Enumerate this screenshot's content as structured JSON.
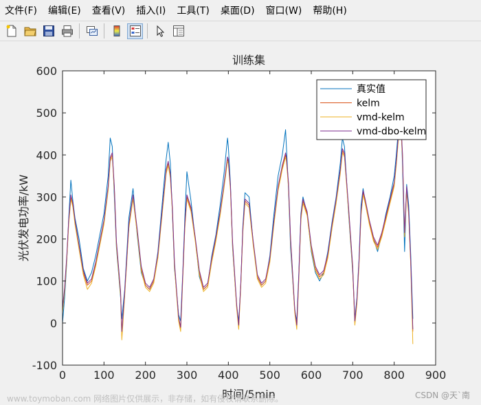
{
  "menubar": {
    "items": [
      "文件(F)",
      "编辑(E)",
      "查看(V)",
      "插入(I)",
      "工具(T)",
      "桌面(D)",
      "窗口(W)",
      "帮助(H)"
    ]
  },
  "toolbar": {
    "icons": [
      "new-figure-icon",
      "open-file-icon",
      "save-icon",
      "print-icon",
      "link-plot-icon",
      "insert-colorbar-icon",
      "insert-legend-icon",
      "pointer-icon",
      "property-inspector-icon"
    ]
  },
  "watermarks": {
    "left": "www.toymoban.com 网络图片仅供展示，非存储，如有侵权请联系删除。",
    "right": "CSDN @天`南"
  },
  "chart_data": {
    "type": "line",
    "title": "训练集",
    "xlabel": "时间/5min",
    "ylabel": "光伏发电功率/kW",
    "xlim": [
      0,
      900
    ],
    "ylim": [
      -100,
      600
    ],
    "xticks": [
      "0",
      "100",
      "200",
      "300",
      "400",
      "500",
      "600",
      "700",
      "800",
      "900"
    ],
    "yticks": [
      "-100",
      "0",
      "100",
      "200",
      "300",
      "400",
      "500",
      "600"
    ],
    "grid": false,
    "legend_position": "top-right",
    "colors": {
      "真实值": "#0072BD",
      "kelm": "#D95319",
      "vmd-kelm": "#EDB120",
      "vmd-dbo-kelm": "#7E2F8E"
    },
    "series": [
      {
        "name": "真实值",
        "x": [
          0,
          5,
          10,
          15,
          20,
          25,
          30,
          40,
          50,
          60,
          70,
          80,
          90,
          100,
          110,
          115,
          120,
          125,
          130,
          140,
          143,
          150,
          160,
          170,
          180,
          190,
          200,
          210,
          220,
          230,
          240,
          250,
          255,
          260,
          265,
          270,
          280,
          285,
          290,
          295,
          300,
          310,
          320,
          330,
          340,
          350,
          360,
          370,
          380,
          390,
          398,
          400,
          405,
          410,
          420,
          425,
          430,
          435,
          440,
          450,
          460,
          470,
          480,
          490,
          500,
          510,
          520,
          530,
          538,
          540,
          545,
          550,
          560,
          565,
          570,
          575,
          580,
          590,
          600,
          610,
          620,
          630,
          640,
          650,
          660,
          670,
          675,
          680,
          690,
          700,
          705,
          710,
          715,
          720,
          725,
          730,
          740,
          750,
          760,
          770,
          780,
          790,
          800,
          805,
          810,
          815,
          820,
          825,
          830,
          835,
          840,
          845
        ],
        "y": [
          0,
          60,
          140,
          250,
          340,
          290,
          250,
          200,
          130,
          100,
          120,
          160,
          210,
          260,
          350,
          440,
          420,
          300,
          180,
          60,
          10,
          80,
          250,
          320,
          210,
          120,
          90,
          80,
          100,
          170,
          280,
          390,
          430,
          380,
          260,
          130,
          20,
          5,
          120,
          250,
          360,
          290,
          200,
          110,
          80,
          90,
          160,
          210,
          280,
          360,
          440,
          420,
          330,
          180,
          40,
          5,
          90,
          230,
          310,
          300,
          190,
          110,
          90,
          100,
          160,
          260,
          350,
          400,
          460,
          420,
          320,
          180,
          30,
          5,
          120,
          260,
          300,
          260,
          170,
          120,
          100,
          120,
          170,
          240,
          300,
          380,
          440,
          420,
          260,
          120,
          10,
          60,
          150,
          280,
          320,
          290,
          240,
          200,
          170,
          210,
          260,
          300,
          350,
          400,
          460,
          520,
          380,
          170,
          330,
          280,
          160,
          10
        ]
      },
      {
        "name": "kelm",
        "x": [
          0,
          5,
          10,
          15,
          20,
          25,
          30,
          40,
          50,
          60,
          70,
          80,
          90,
          100,
          110,
          115,
          120,
          125,
          130,
          140,
          143,
          150,
          160,
          170,
          180,
          190,
          200,
          210,
          220,
          230,
          240,
          250,
          255,
          260,
          265,
          270,
          280,
          285,
          290,
          295,
          300,
          310,
          320,
          330,
          340,
          350,
          360,
          370,
          380,
          390,
          398,
          400,
          405,
          410,
          420,
          425,
          430,
          435,
          440,
          450,
          460,
          470,
          480,
          490,
          500,
          510,
          520,
          530,
          538,
          540,
          545,
          550,
          560,
          565,
          570,
          575,
          580,
          590,
          600,
          610,
          620,
          630,
          640,
          650,
          660,
          670,
          675,
          680,
          690,
          700,
          705,
          710,
          715,
          720,
          725,
          730,
          740,
          750,
          760,
          770,
          780,
          790,
          800,
          805,
          810,
          815,
          820,
          825,
          830,
          835,
          840,
          845
        ],
        "y": [
          30,
          80,
          150,
          240,
          300,
          280,
          240,
          180,
          120,
          90,
          100,
          140,
          190,
          240,
          320,
          390,
          400,
          320,
          190,
          70,
          -30,
          70,
          230,
          300,
          220,
          130,
          90,
          80,
          100,
          160,
          260,
          360,
          380,
          350,
          270,
          140,
          10,
          -15,
          110,
          230,
          300,
          270,
          200,
          120,
          80,
          90,
          150,
          200,
          260,
          330,
          390,
          385,
          320,
          190,
          40,
          -10,
          90,
          220,
          290,
          280,
          190,
          110,
          90,
          100,
          150,
          240,
          320,
          370,
          400,
          390,
          330,
          200,
          30,
          -10,
          110,
          250,
          290,
          260,
          180,
          130,
          110,
          120,
          160,
          230,
          290,
          360,
          410,
          400,
          270,
          130,
          0,
          50,
          140,
          260,
          310,
          290,
          240,
          200,
          180,
          210,
          250,
          290,
          330,
          380,
          440,
          490,
          400,
          210,
          320,
          260,
          140,
          -20
        ]
      },
      {
        "name": "vmd-kelm",
        "x": [
          0,
          5,
          10,
          15,
          20,
          25,
          30,
          40,
          50,
          60,
          70,
          80,
          90,
          100,
          110,
          115,
          120,
          125,
          130,
          140,
          143,
          150,
          160,
          170,
          180,
          190,
          200,
          210,
          220,
          230,
          240,
          250,
          255,
          260,
          265,
          270,
          280,
          285,
          290,
          295,
          300,
          310,
          320,
          330,
          340,
          350,
          360,
          370,
          380,
          390,
          398,
          400,
          405,
          410,
          420,
          425,
          430,
          435,
          440,
          450,
          460,
          470,
          480,
          490,
          500,
          510,
          520,
          530,
          538,
          540,
          545,
          550,
          560,
          565,
          570,
          575,
          580,
          590,
          600,
          610,
          620,
          630,
          640,
          650,
          660,
          670,
          675,
          680,
          690,
          700,
          705,
          710,
          715,
          720,
          725,
          730,
          740,
          750,
          760,
          770,
          780,
          790,
          800,
          805,
          810,
          815,
          820,
          825,
          830,
          835,
          840,
          845
        ],
        "y": [
          25,
          75,
          145,
          235,
          295,
          275,
          235,
          175,
          115,
          80,
          95,
          135,
          185,
          235,
          315,
          385,
          395,
          315,
          185,
          65,
          -40,
          65,
          225,
          295,
          215,
          125,
          85,
          75,
          95,
          155,
          255,
          355,
          375,
          345,
          265,
          135,
          5,
          -20,
          105,
          225,
          295,
          265,
          195,
          115,
          75,
          85,
          145,
          195,
          255,
          325,
          385,
          380,
          315,
          185,
          35,
          -15,
          85,
          215,
          285,
          275,
          185,
          105,
          85,
          95,
          145,
          235,
          315,
          365,
          395,
          385,
          325,
          195,
          25,
          -15,
          105,
          245,
          285,
          255,
          175,
          125,
          105,
          115,
          155,
          225,
          285,
          355,
          405,
          395,
          265,
          125,
          -5,
          45,
          135,
          255,
          305,
          285,
          235,
          195,
          175,
          205,
          245,
          285,
          325,
          375,
          435,
          485,
          395,
          205,
          315,
          255,
          135,
          -50
        ]
      },
      {
        "name": "vmd-dbo-kelm",
        "x": [
          0,
          5,
          10,
          15,
          20,
          25,
          30,
          40,
          50,
          60,
          70,
          80,
          90,
          100,
          110,
          115,
          120,
          125,
          130,
          140,
          143,
          150,
          160,
          170,
          180,
          190,
          200,
          210,
          220,
          230,
          240,
          250,
          255,
          260,
          265,
          270,
          280,
          285,
          290,
          295,
          300,
          310,
          320,
          330,
          340,
          350,
          360,
          370,
          380,
          390,
          398,
          400,
          405,
          410,
          420,
          425,
          430,
          435,
          440,
          450,
          460,
          470,
          480,
          490,
          500,
          510,
          520,
          530,
          538,
          540,
          545,
          550,
          560,
          565,
          570,
          575,
          580,
          590,
          600,
          610,
          620,
          630,
          640,
          650,
          660,
          670,
          675,
          680,
          690,
          700,
          705,
          710,
          715,
          720,
          725,
          730,
          740,
          750,
          760,
          770,
          780,
          790,
          800,
          805,
          810,
          815,
          820,
          825,
          830,
          835,
          840,
          845
        ],
        "y": [
          35,
          85,
          155,
          245,
          305,
          285,
          245,
          185,
          125,
          95,
          105,
          145,
          195,
          245,
          325,
          395,
          405,
          325,
          195,
          75,
          -20,
          75,
          235,
          305,
          225,
          135,
          95,
          85,
          105,
          165,
          265,
          365,
          385,
          355,
          275,
          145,
          15,
          -10,
          115,
          235,
          305,
          275,
          205,
          125,
          85,
          95,
          155,
          205,
          265,
          335,
          395,
          390,
          325,
          195,
          45,
          -5,
          95,
          225,
          295,
          285,
          195,
          115,
          95,
          105,
          155,
          245,
          325,
          375,
          405,
          395,
          335,
          205,
          35,
          -5,
          115,
          255,
          295,
          265,
          185,
          135,
          115,
          125,
          165,
          235,
          295,
          365,
          415,
          405,
          275,
          135,
          5,
          55,
          145,
          265,
          315,
          295,
          245,
          205,
          185,
          215,
          255,
          295,
          335,
          385,
          445,
          495,
          405,
          215,
          325,
          265,
          145,
          -15
        ]
      }
    ]
  }
}
